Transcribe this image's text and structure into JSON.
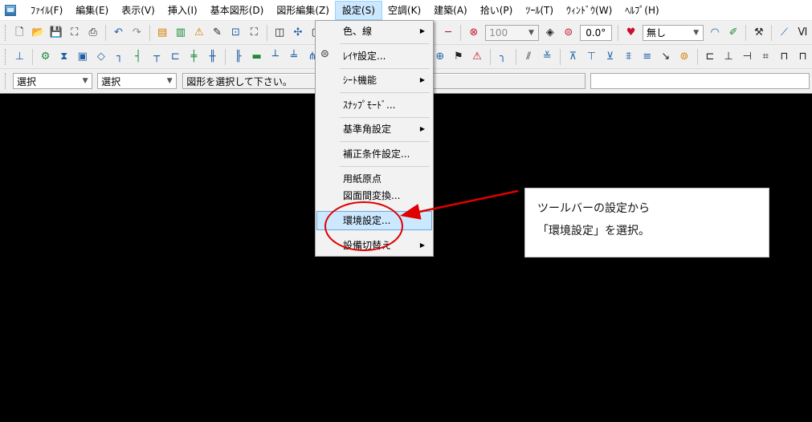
{
  "menu": {
    "items": [
      {
        "label": "ﾌｧｲﾙ(F)"
      },
      {
        "label": "編集(E)"
      },
      {
        "label": "表示(V)"
      },
      {
        "label": "挿入(I)"
      },
      {
        "label": "基本図形(D)"
      },
      {
        "label": "図形編集(Z)"
      },
      {
        "label": "設定(S)"
      },
      {
        "label": "空調(K)"
      },
      {
        "label": "建築(A)"
      },
      {
        "label": "拾い(P)"
      },
      {
        "label": "ﾂｰﾙ(T)"
      },
      {
        "label": "ｳｨﾝﾄﾞｳ(W)"
      },
      {
        "label": "ﾍﾙﾌﾟ(H)"
      }
    ]
  },
  "toolbar1": {
    "scale_value": "100",
    "angle_value": "0.0°",
    "linetype_value": "無し"
  },
  "selectbar": {
    "combo1_value": "選択",
    "combo2_value": "選択",
    "prompt": "図形を選択して下さい。"
  },
  "dropdown": {
    "items": [
      {
        "label": "色、線",
        "submenu": true
      },
      {
        "label": "ﾚｲﾔ設定...",
        "submenu": false
      },
      {
        "label": "ｼｰﾄ機能",
        "submenu": true
      },
      {
        "label": "ｽﾅｯﾌﾟﾓｰﾄﾞ...",
        "submenu": false
      },
      {
        "label": "基準角設定",
        "submenu": true
      },
      {
        "label": "補正条件設定...",
        "submenu": false
      },
      {
        "label": "用紙原点",
        "submenu": false
      },
      {
        "label": "図面間変換...",
        "submenu": false
      },
      {
        "label": "環境設定...",
        "submenu": false
      },
      {
        "label": "設備切替え",
        "submenu": true
      }
    ],
    "submenu_arrow": "▶"
  },
  "annotation": {
    "line1": "ツールバーの設定から",
    "line2": "「環境設定」を選択。",
    "color": "#e00000"
  }
}
